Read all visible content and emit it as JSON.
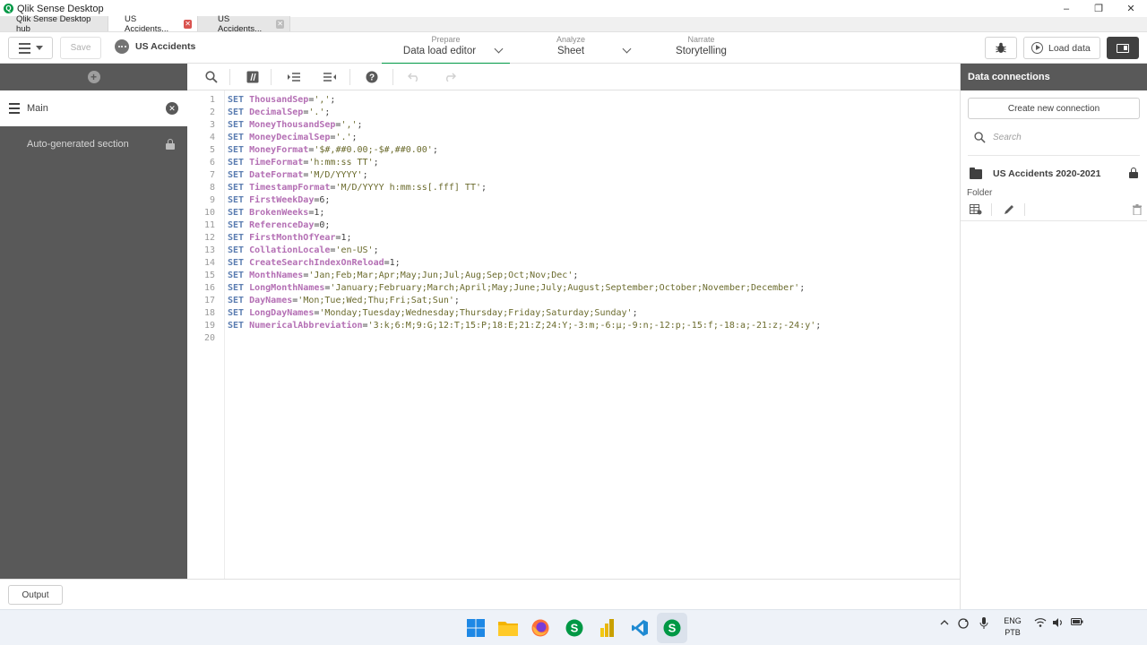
{
  "window": {
    "title": "Qlik Sense Desktop",
    "logo_letter": "Q",
    "controls": [
      "–",
      "❐",
      "✕"
    ]
  },
  "tabs": [
    {
      "label": "Qlik Sense Desktop hub",
      "close": false
    },
    {
      "label": "US Accidents...",
      "close": true,
      "close_color": "red"
    },
    {
      "label": "US Accidents...",
      "close": true,
      "close_color": "grey"
    }
  ],
  "toolbar": {
    "save_label": "Save",
    "app_name": "US Accidents",
    "prepare_small": "Prepare",
    "prepare_big": "Data load editor",
    "analyze_small": "Analyze",
    "analyze_big": "Sheet",
    "narrate_small": "Narrate",
    "narrate_big": "Storytelling",
    "load_data_label": "Load data"
  },
  "sidebar": {
    "main_label": "Main",
    "auto_section_label": "Auto-generated section"
  },
  "editor": {
    "line_numbers": [
      "1",
      "2",
      "3",
      "4",
      "5",
      "6",
      "7",
      "8",
      "9",
      "10",
      "11",
      "12",
      "13",
      "14",
      "15",
      "16",
      "17",
      "18",
      "19",
      "20"
    ],
    "lines": [
      {
        "kw": "SET",
        "var": "ThousandSep",
        "val": "','",
        "type": "str"
      },
      {
        "kw": "SET",
        "var": "DecimalSep",
        "val": "'.'",
        "type": "str"
      },
      {
        "kw": "SET",
        "var": "MoneyThousandSep",
        "val": "','",
        "type": "str"
      },
      {
        "kw": "SET",
        "var": "MoneyDecimalSep",
        "val": "'.'",
        "type": "str"
      },
      {
        "kw": "SET",
        "var": "MoneyFormat",
        "val": "'$#,##0.00;-$#,##0.00'",
        "type": "str"
      },
      {
        "kw": "SET",
        "var": "TimeFormat",
        "val": "'h:mm:ss TT'",
        "type": "str"
      },
      {
        "kw": "SET",
        "var": "DateFormat",
        "val": "'M/D/YYYY'",
        "type": "str"
      },
      {
        "kw": "SET",
        "var": "TimestampFormat",
        "val": "'M/D/YYYY h:mm:ss[.fff] TT'",
        "type": "str"
      },
      {
        "kw": "SET",
        "var": "FirstWeekDay",
        "val": "6",
        "type": "num"
      },
      {
        "kw": "SET",
        "var": "BrokenWeeks",
        "val": "1",
        "type": "num"
      },
      {
        "kw": "SET",
        "var": "ReferenceDay",
        "val": "0",
        "type": "num"
      },
      {
        "kw": "SET",
        "var": "FirstMonthOfYear",
        "val": "1",
        "type": "num"
      },
      {
        "kw": "SET",
        "var": "CollationLocale",
        "val": "'en-US'",
        "type": "str"
      },
      {
        "kw": "SET",
        "var": "CreateSearchIndexOnReload",
        "val": "1",
        "type": "num"
      },
      {
        "kw": "SET",
        "var": "MonthNames",
        "val": "'Jan;Feb;Mar;Apr;May;Jun;Jul;Aug;Sep;Oct;Nov;Dec'",
        "type": "str"
      },
      {
        "kw": "SET",
        "var": "LongMonthNames",
        "val": "'January;February;March;April;May;June;July;August;September;October;November;December'",
        "type": "str"
      },
      {
        "kw": "SET",
        "var": "DayNames",
        "val": "'Mon;Tue;Wed;Thu;Fri;Sat;Sun'",
        "type": "str"
      },
      {
        "kw": "SET",
        "var": "LongDayNames",
        "val": "'Monday;Tuesday;Wednesday;Thursday;Friday;Saturday;Sunday'",
        "type": "str"
      },
      {
        "kw": "SET",
        "var": "NumericalAbbreviation",
        "val": "'3:k;6:M;9:G;12:T;15:P;18:E;21:Z;24:Y;-3:m;-6:μ;-9:n;-12:p;-15:f;-18:a;-21:z;-24:y'",
        "type": "str"
      }
    ]
  },
  "right_panel": {
    "header": "Data connections",
    "create_label": "Create new connection",
    "search_placeholder": "Search",
    "connection_name": "US Accidents 2020-2021",
    "connection_type": "Folder"
  },
  "bottom": {
    "output_label": "Output"
  },
  "taskbar": {
    "lang_top": "ENG",
    "lang_bottom": "PTB"
  },
  "colors": {
    "accent": "#009845",
    "sidebar": "#595959",
    "keyword": "#5b7db1",
    "variable": "#b46fb4",
    "string": "#6b6b2d"
  }
}
